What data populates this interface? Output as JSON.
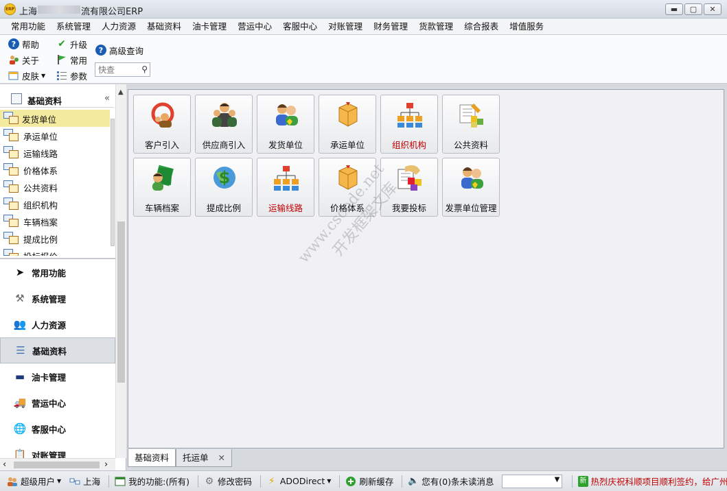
{
  "window": {
    "title_prefix": "上海",
    "title_suffix": "流有限公司ERP",
    "app_icon_text": "ERP",
    "minimize": "▬",
    "maximize": "▢",
    "close": "✕"
  },
  "menu": [
    "常用功能",
    "系统管理",
    "人力资源",
    "基础资料",
    "油卡管理",
    "营运中心",
    "客服中心",
    "对账管理",
    "财务管理",
    "货款管理",
    "综合报表",
    "增值服务"
  ],
  "toolbar": {
    "help": "帮助",
    "upgrade": "升级",
    "advanced_query": "高级查询",
    "about": "关于",
    "common": "常用",
    "skin": "皮肤",
    "params": "参数",
    "search_placeholder": "快查"
  },
  "sidebar": {
    "header": "基础资料",
    "collapse_glyph": "«",
    "tree_items": [
      "发货单位",
      "承运单位",
      "运输线路",
      "价格体系",
      "公共资料",
      "组织机构",
      "车辆档案",
      "提成比例",
      "投标报价"
    ],
    "nav_items": [
      {
        "label": "常用功能",
        "icon": "cursor-icon"
      },
      {
        "label": "系统管理",
        "icon": "tools-icon"
      },
      {
        "label": "人力资源",
        "icon": "people-icon"
      },
      {
        "label": "基础资料",
        "icon": "list-icon"
      },
      {
        "label": "油卡管理",
        "icon": "card-icon"
      },
      {
        "label": "营运中心",
        "icon": "truck-icon"
      },
      {
        "label": "客服中心",
        "icon": "globe-icon"
      },
      {
        "label": "对账管理",
        "icon": "clipboard-icon"
      }
    ]
  },
  "tiles": [
    {
      "label": "客户引入",
      "icon": "customer-import-icon",
      "red": false
    },
    {
      "label": "供应商引入",
      "icon": "supplier-import-icon",
      "red": false
    },
    {
      "label": "发货单位",
      "icon": "shipper-icon",
      "red": false
    },
    {
      "label": "承运单位",
      "icon": "carrier-box-icon",
      "red": false
    },
    {
      "label": "组织机构",
      "icon": "org-chart-icon",
      "red": true
    },
    {
      "label": "公共资料",
      "icon": "public-data-icon",
      "red": false
    },
    {
      "label": "车辆档案",
      "icon": "vehicle-file-icon",
      "red": false
    },
    {
      "label": "提成比例",
      "icon": "commission-icon",
      "red": false
    },
    {
      "label": "运输线路",
      "icon": "route-icon",
      "red": true
    },
    {
      "label": "价格体系",
      "icon": "price-box-icon",
      "red": false
    },
    {
      "label": "我要投标",
      "icon": "bid-icon",
      "red": false
    },
    {
      "label": "发票单位管理",
      "icon": "invoice-unit-icon",
      "red": false
    }
  ],
  "tabs": [
    {
      "label": "基础资料",
      "closable": false
    },
    {
      "label": "托运单",
      "closable": true
    }
  ],
  "status": {
    "user": "超级用户",
    "location": "上海",
    "my_functions": "我的功能:(所有)",
    "change_password": "修改密码",
    "ado": "ADODirect",
    "refresh_cache": "刷新缓存",
    "messages": "您有(0)条未读消息",
    "ticker": "热烈庆祝科顺项目顺利签约，给广州事业部"
  },
  "watermark": {
    "line1": "www.cscode.net",
    "line2": "开发框架文库"
  },
  "colors": {
    "highlight_red": "#c00000",
    "selected_tree": "#f4eba0"
  }
}
